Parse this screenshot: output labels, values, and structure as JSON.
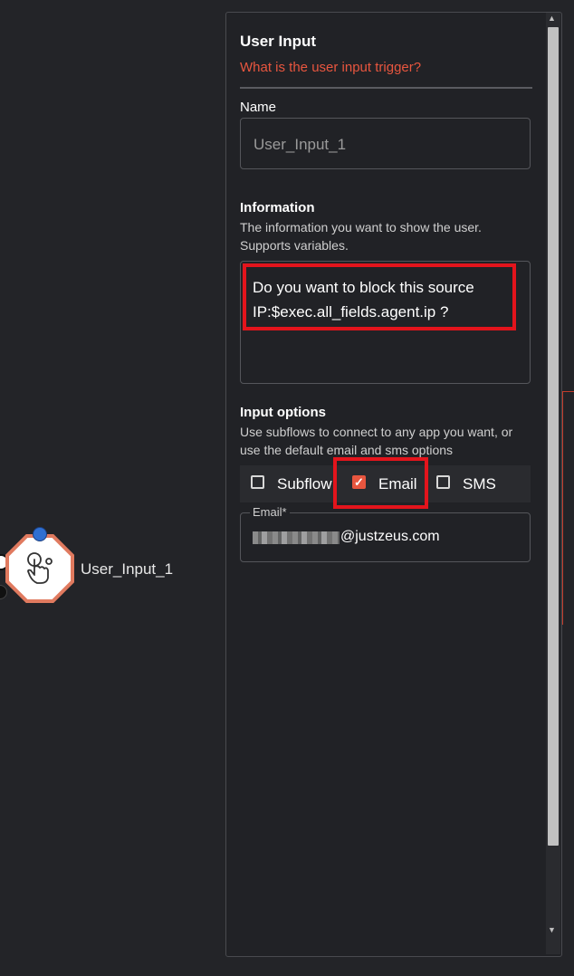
{
  "canvas": {
    "node_label": "User_Input_1"
  },
  "panel": {
    "title": "User Input",
    "subtitle": "What is the user input trigger?",
    "name": {
      "label": "Name",
      "value": "User_Input_1"
    },
    "information": {
      "label": "Information",
      "description": "The information you want to show the user. Supports variables.",
      "value": "Do you want to block this source IP:$exec.all_fields.agent.ip ?"
    },
    "input_options": {
      "label": "Input options",
      "description": "Use subflows to connect to any app you want, or use the default email and sms options",
      "options": [
        {
          "label": "Subflow",
          "checked": false
        },
        {
          "label": "Email",
          "checked": true
        },
        {
          "label": "SMS",
          "checked": false
        }
      ]
    },
    "email": {
      "label": "Email",
      "required_mark": "*",
      "value_visible_suffix": "@justzeus.com"
    }
  },
  "colors": {
    "accent": "#e8563f",
    "highlight": "#e3141c",
    "background": "#232428",
    "node_port": "#2f6fd1"
  },
  "icons": {
    "node_icon": "touch-hand-icon",
    "checkbox_checked": "check-icon"
  }
}
